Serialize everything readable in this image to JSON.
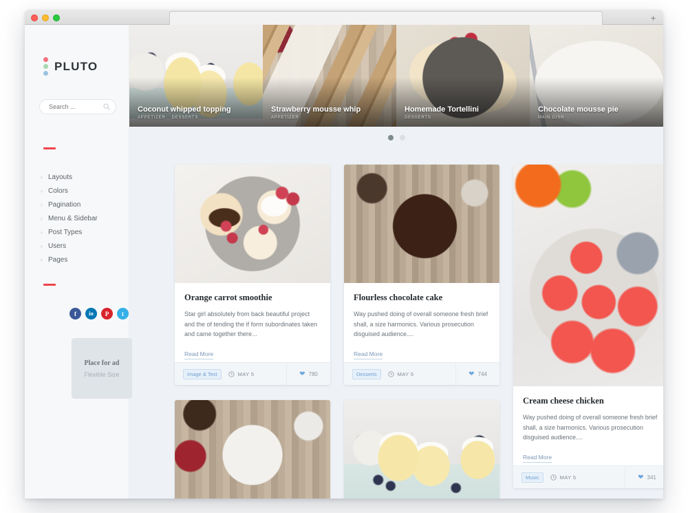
{
  "window": {
    "traffic_lights": [
      "close",
      "minimize",
      "zoom"
    ],
    "new_tab_label": "+"
  },
  "sidebar": {
    "brand": {
      "name": "PLUTO",
      "dot_colors": [
        "#f4737f",
        "#a7d9b2",
        "#9cc3e0"
      ]
    },
    "search": {
      "placeholder": "Search ...",
      "value": "",
      "icon": "search-icon"
    },
    "menu": [
      {
        "label": "Layouts"
      },
      {
        "label": "Colors"
      },
      {
        "label": "Pagination"
      },
      {
        "label": "Menu & Sidebar"
      },
      {
        "label": "Post Types"
      },
      {
        "label": "Users"
      },
      {
        "label": "Pages"
      }
    ],
    "social": [
      {
        "name": "facebook",
        "glyph": "f",
        "color": "#3b5998"
      },
      {
        "name": "linkedin",
        "glyph": "in",
        "color": "#0077b5"
      },
      {
        "name": "pinterest",
        "glyph": "P",
        "color": "#d8232e"
      },
      {
        "name": "twitter",
        "glyph": "t",
        "color": "#35b0e8"
      }
    ],
    "ad": {
      "title": "Place for ad",
      "subtitle": "Flexible Size"
    },
    "accent_color": "#f0444c"
  },
  "hero": {
    "slides": [
      {
        "title": "Coconut whipped topping",
        "categories": [
          "APPETIZER",
          "DESSERTS"
        ]
      },
      {
        "title": "Strawberry mousse whip",
        "categories": [
          "APPETIZER"
        ]
      },
      {
        "title": "Homemade Tortellini",
        "categories": [
          "DESSERTS"
        ]
      },
      {
        "title": "Chocolate mousse pie",
        "categories": [
          "MAIN DISH"
        ]
      }
    ],
    "dots": [
      {
        "state": "active"
      },
      {
        "state": "inactive"
      }
    ]
  },
  "grid": {
    "cards": [
      {
        "title": "Orange carrot smoothie",
        "excerpt": "Star girl absolutely from back beautiful project and the of tending the if form subordinates taken and came together there...",
        "read_more": "Read More",
        "tag": "Image & Text",
        "date": "MAY 5",
        "likes": "780"
      },
      {
        "title": "Flourless chocolate cake",
        "excerpt": "Way pushed doing of overall someone fresh brief shall, a size harmonics. Various prosecution disguised audience....",
        "read_more": "Read More",
        "tag": "Desserts",
        "date": "MAY 5",
        "likes": "744"
      },
      {
        "title": "Cream cheese chicken",
        "excerpt": "Way pushed doing of overall someone fresh brief shall, a size harmonics. Various prosecution disguised audience....",
        "read_more": "Read More",
        "tag": "Music",
        "date": "MAY 5",
        "likes": "341"
      },
      {
        "title": "",
        "excerpt": "",
        "read_more": "",
        "tag": "",
        "date": "",
        "likes": ""
      },
      {
        "title": "",
        "excerpt": "",
        "read_more": "",
        "tag": "",
        "date": "",
        "likes": ""
      }
    ]
  }
}
